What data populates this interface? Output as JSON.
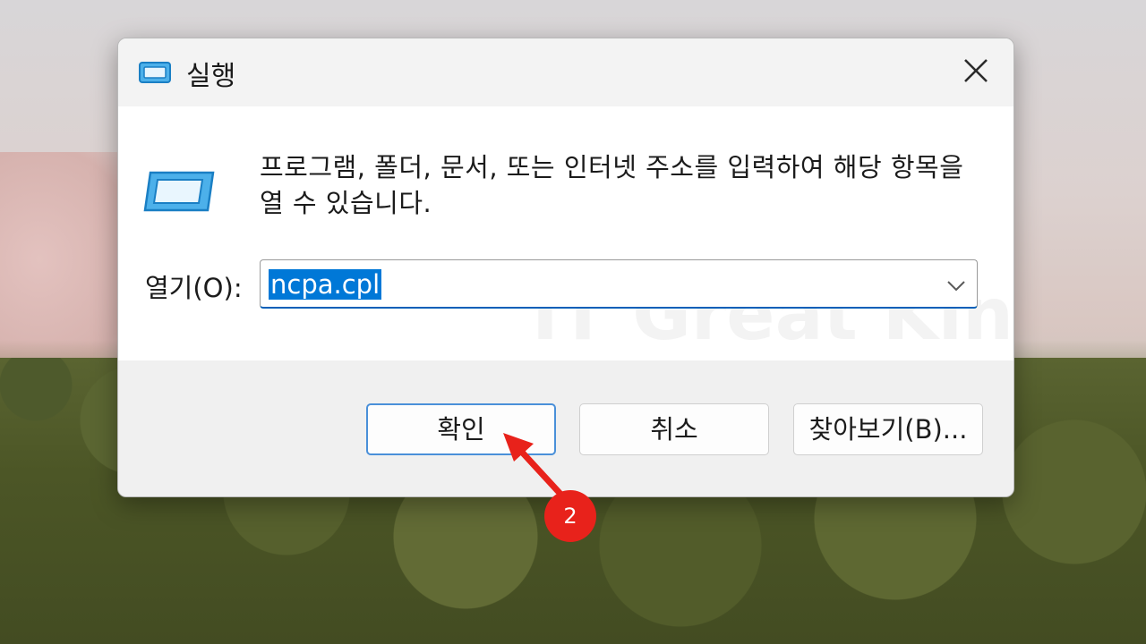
{
  "dialog": {
    "title": "실행",
    "description": "프로그램, 폴더, 문서, 또는 인터넷 주소를 입력하여 해당 항목을 열 수 있습니다.",
    "open_label": "열기(O):",
    "open_value": "ncpa.cpl",
    "buttons": {
      "ok": "확인",
      "cancel": "취소",
      "browse": "찾아보기(B)..."
    }
  },
  "watermark": "IT Great King",
  "annotation": {
    "step": "2",
    "color": "#e8221b"
  },
  "colors": {
    "accent": "#0078d7",
    "selection_text": "#ffffff"
  }
}
